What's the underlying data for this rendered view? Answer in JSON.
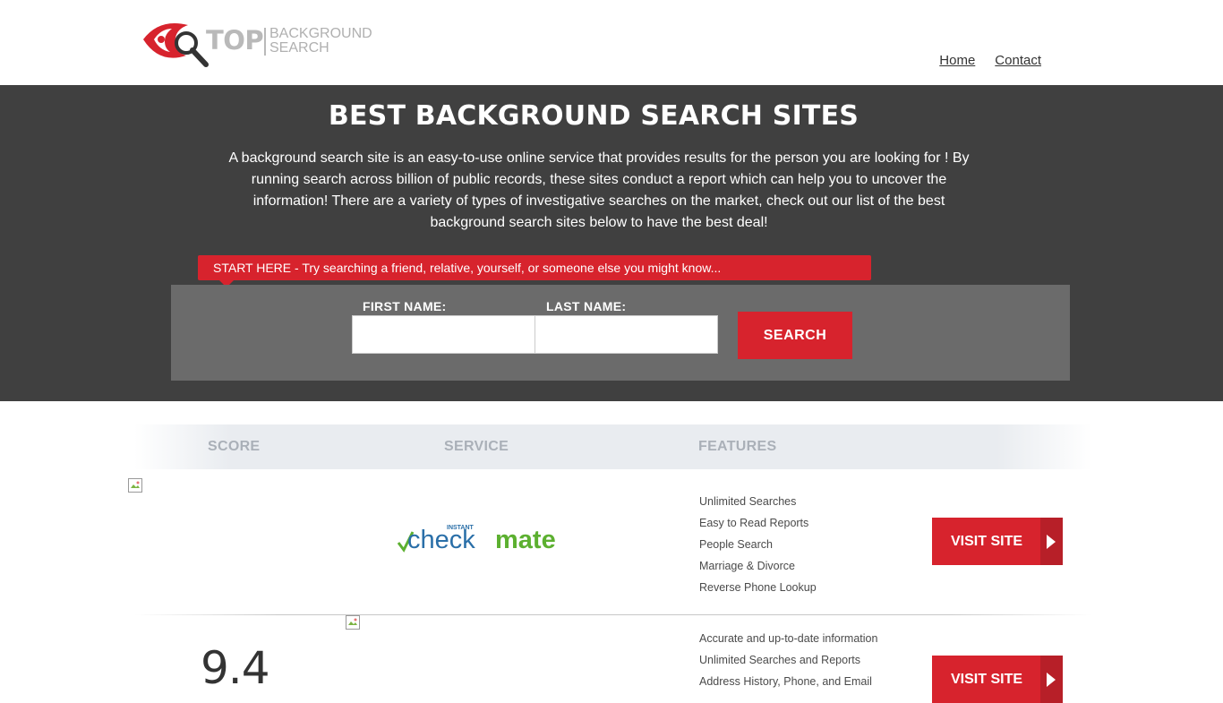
{
  "header": {
    "logo_top": "TOP",
    "logo_sub_line1": "BACKGROUND",
    "logo_sub_line2": "SEARCH",
    "nav": [
      {
        "label": "Home"
      },
      {
        "label": "Contact"
      }
    ]
  },
  "hero": {
    "title": "BEST BACKGROUND SEARCH SITES",
    "description": "A background search site is an easy-to-use online service that provides results  for the person you are looking for ! By  running  search across billion of public records, these sites conduct  a report which can help you to uncover the information! There are a variety of types of investigative searches on the market, check out our  list of the best background search sites below to have the best deal!",
    "banner": "START HERE - Try searching a friend, relative, yourself, or someone else you might know...",
    "first_name_label": "FIRST NAME:",
    "last_name_label": "LAST NAME:",
    "first_name_value": "",
    "last_name_value": "",
    "search_button": "SEARCH"
  },
  "table": {
    "headers": {
      "score": "SCORE",
      "service": "SERVICE",
      "features": "FEATURES"
    },
    "rows": [
      {
        "score": "",
        "brand": {
          "small": "INSTANT",
          "part1": "check",
          "part2": "mate"
        },
        "features": [
          "Unlimited Searches",
          "Easy to Read Reports",
          "People Search",
          "Marriage & Divorce",
          "Reverse Phone Lookup"
        ],
        "cta": "VISIT SITE"
      },
      {
        "score": "9.4",
        "features": [
          "Accurate and up-to-date information",
          "Unlimited Searches and Reports",
          "Address History, Phone, and Email"
        ],
        "cta": "VISIT SITE"
      }
    ]
  },
  "colors": {
    "accent": "#d7232d",
    "dark_bg": "#404040",
    "search_bg": "#6b6b6b",
    "header_bg": "#e9ecf0"
  }
}
